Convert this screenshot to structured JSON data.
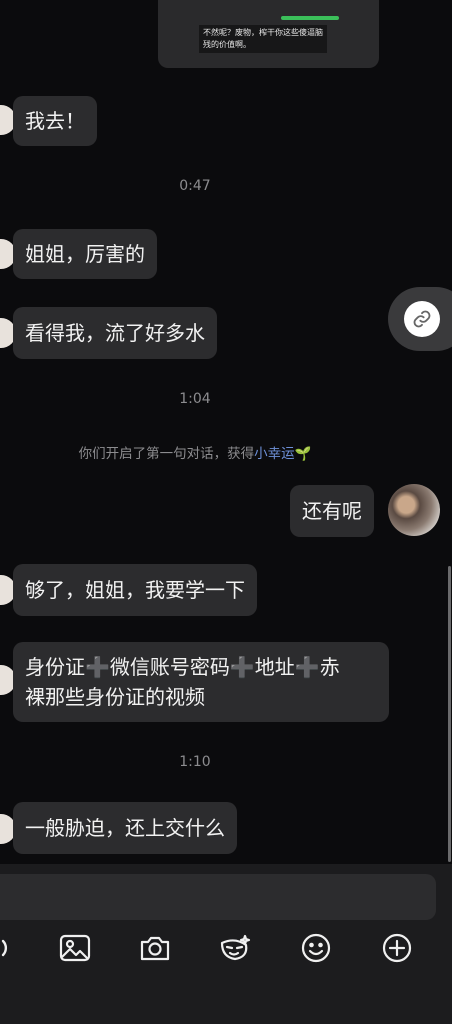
{
  "top_image_message": {
    "caption": "不然呢？废物，榨干你这些傻逼脑残的价值啊。"
  },
  "messages": [
    {
      "text": "我去！"
    },
    {
      "text": "姐姐，厉害的"
    },
    {
      "text": "看得我，流了好多水"
    },
    {
      "text": "还有呢"
    },
    {
      "text": "够了，姐姐，我要学一下"
    },
    {
      "text_line1": "身份证➕微信账号密码➕地址➕赤",
      "text_line2": "裸那些身份证的视频"
    },
    {
      "text": "一般胁迫，还上交什么"
    }
  ],
  "timestamps": [
    "0:47",
    "1:04",
    "1:10"
  ],
  "system_notice": {
    "prefix": "你们开启了第一句对话，获得",
    "lucky": "小幸运",
    "sprout": "🌱"
  },
  "toolbar": {
    "icons": [
      "voice-icon",
      "image-icon",
      "camera-icon",
      "sticker-mask-icon",
      "emoji-icon",
      "plus-icon"
    ]
  },
  "colors": {
    "background": "#0b0b0d",
    "bubble": "#2c2c2e",
    "link_accent": "#6d8fd6"
  }
}
